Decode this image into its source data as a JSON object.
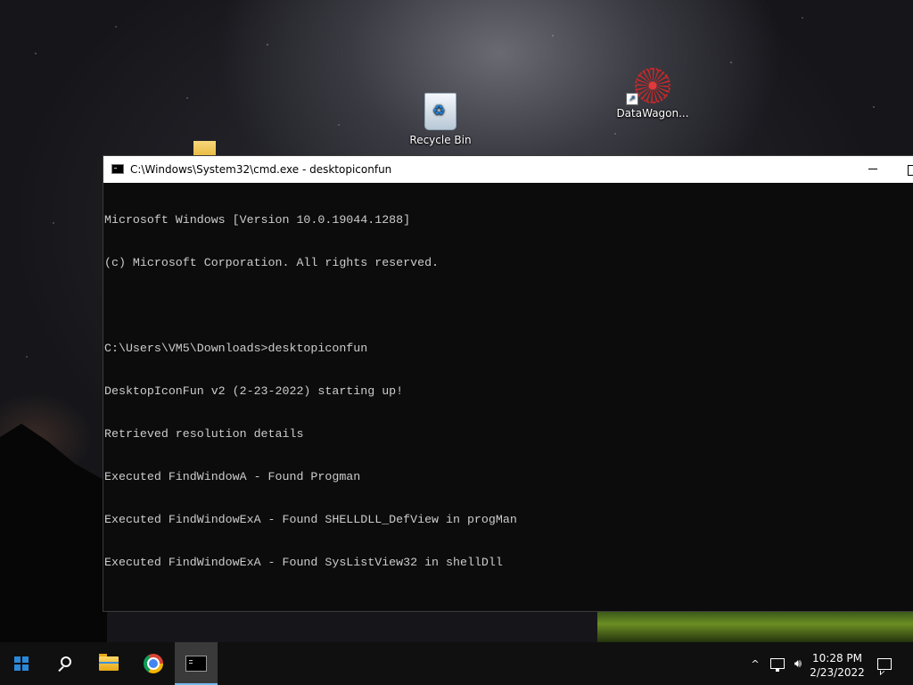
{
  "desktop": {
    "icons": [
      {
        "label": "Recycle Bin",
        "icon": "recycle-bin-icon"
      },
      {
        "label": "DataWagon...",
        "icon": "datawagon-shortcut-icon"
      }
    ]
  },
  "window": {
    "title": "C:\\Windows\\System32\\cmd.exe - desktopiconfun",
    "console_lines": [
      "Microsoft Windows [Version 10.0.19044.1288]",
      "(c) Microsoft Corporation. All rights reserved.",
      "",
      "C:\\Users\\VM5\\Downloads>desktopiconfun",
      "DesktopIconFun v2 (2-23-2022) starting up!",
      "Retrieved resolution details",
      "Executed FindWindowA - Found Progman",
      "Executed FindWindowExA - Found SHELLDLL_DefView in progMan",
      "Executed FindWindowExA - Found SysListView32 in shellDll"
    ]
  },
  "taskbar": {
    "apps": [
      "start-icon",
      "search-icon",
      "file-explorer-icon",
      "chrome-icon",
      "cmd-icon"
    ],
    "tray": {
      "chevron": "^",
      "time": "10:28 PM",
      "date": "2/23/2022"
    }
  },
  "colors": {
    "console_bg": "#0c0c0c",
    "console_fg": "#cccccc",
    "taskbar_bg": "#101010",
    "accent": "#2b88d8"
  }
}
